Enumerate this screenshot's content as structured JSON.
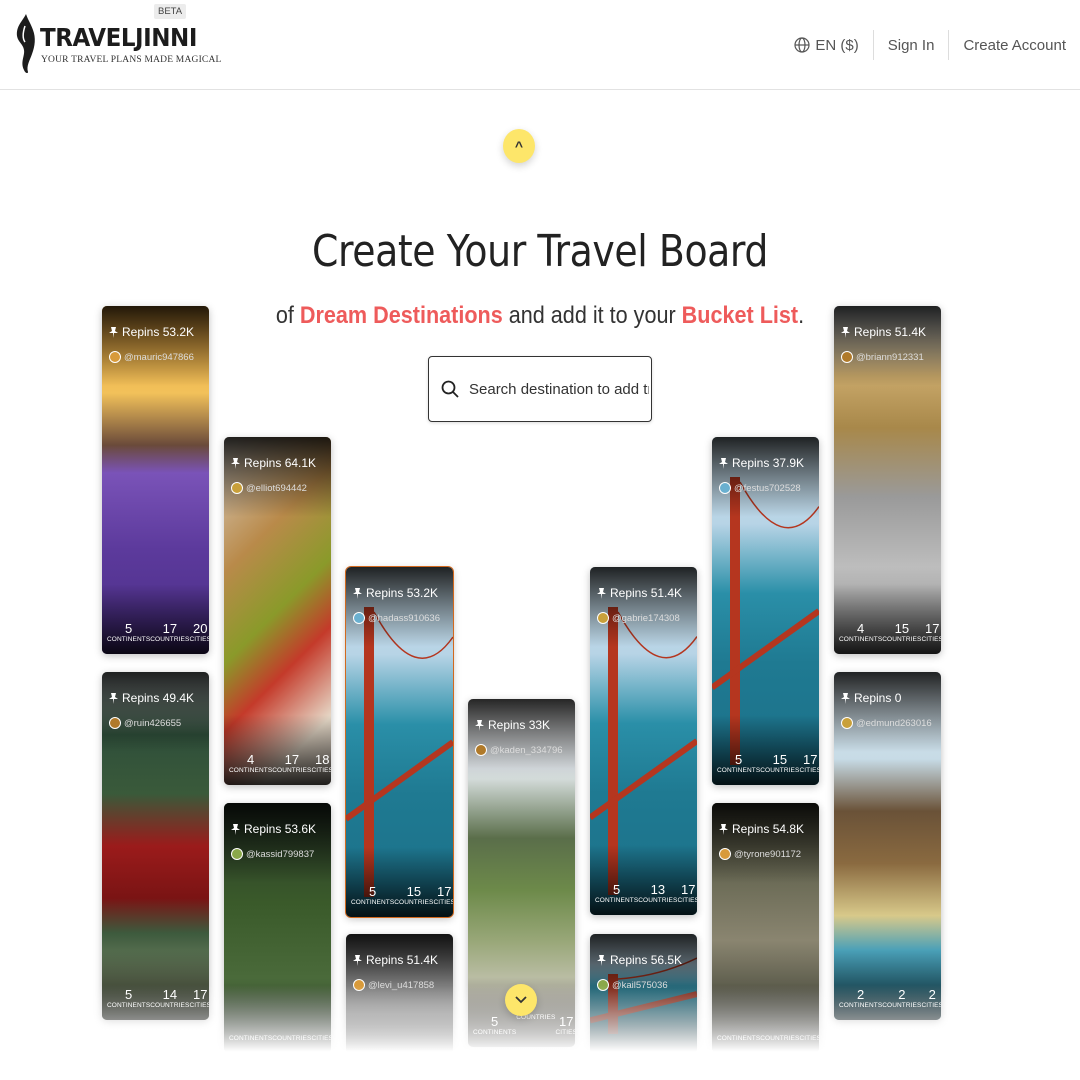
{
  "header": {
    "brand": "TRAVELJINNI",
    "tagline": "YOUR TRAVEL PLANS MADE MAGICAL",
    "beta": "BETA",
    "language": "EN ($)",
    "sign_in": "Sign In",
    "create_account": "Create Account"
  },
  "hero": {
    "title": "Create Your Travel Board",
    "sub_of": "of",
    "sub_accent1": "Dream Destinations",
    "sub_mid": "and add it to your",
    "sub_accent2": "Bucket List",
    "sub_end": ".",
    "search_placeholder": "Search destination to add trip"
  },
  "colors": {
    "accent": "#ee5b5b",
    "button_yellow": "#fde66a"
  },
  "stat_labels": {
    "continents": "CONTINENTS",
    "countries": "COUNTRIES",
    "cities": "CITIES"
  },
  "cards": [
    {
      "repins": "Repins 53.2K",
      "user": "@mauric947866",
      "continents": "5",
      "countries": "17",
      "cities": "20",
      "scene": "lavender"
    },
    {
      "repins": "Repins 49.4K",
      "user": "@ruin426655",
      "continents": "5",
      "countries": "14",
      "cities": "17",
      "scene": "temple"
    },
    {
      "repins": "Repins 64.1K",
      "user": "@elliot694442",
      "continents": "4",
      "countries": "17",
      "cities": "18",
      "scene": "dancer"
    },
    {
      "repins": "Repins 53.6K",
      "user": "@kassid799837",
      "continents": "",
      "countries": "",
      "cities": "",
      "scene": "forest"
    },
    {
      "repins": "Repins 53.2K",
      "user": "@hadass910636",
      "continents": "5",
      "countries": "15",
      "cities": "17",
      "scene": "bridge"
    },
    {
      "repins": "Repins 51.4K",
      "user": "@levi_u417858",
      "continents": "",
      "countries": "",
      "cities": "",
      "scene": "room"
    },
    {
      "repins": "Repins 33K",
      "user": "@kaden_334796",
      "continents": "5",
      "countries": "",
      "cities": "17",
      "scene": "hills"
    },
    {
      "repins": "Repins 51.4K",
      "user": "@gabrie174308",
      "continents": "5",
      "countries": "13",
      "cities": "17",
      "scene": "bridge"
    },
    {
      "repins": "Repins 56.5K",
      "user": "@kail575036",
      "continents": "",
      "countries": "",
      "cities": "",
      "scene": "bridge"
    },
    {
      "repins": "Repins 37.9K",
      "user": "@festus702528",
      "continents": "5",
      "countries": "15",
      "cities": "17",
      "scene": "bridge"
    },
    {
      "repins": "Repins 54.8K",
      "user": "@tyrone901172",
      "continents": "",
      "countries": "",
      "cities": "",
      "scene": "cliff"
    },
    {
      "repins": "Repins 51.4K",
      "user": "@briann912331",
      "continents": "4",
      "countries": "15",
      "cities": "17",
      "scene": "palace"
    },
    {
      "repins": "Repins 0",
      "user": "@edmund263016",
      "continents": "2",
      "countries": "2",
      "cities": "2",
      "scene": "hut"
    }
  ]
}
